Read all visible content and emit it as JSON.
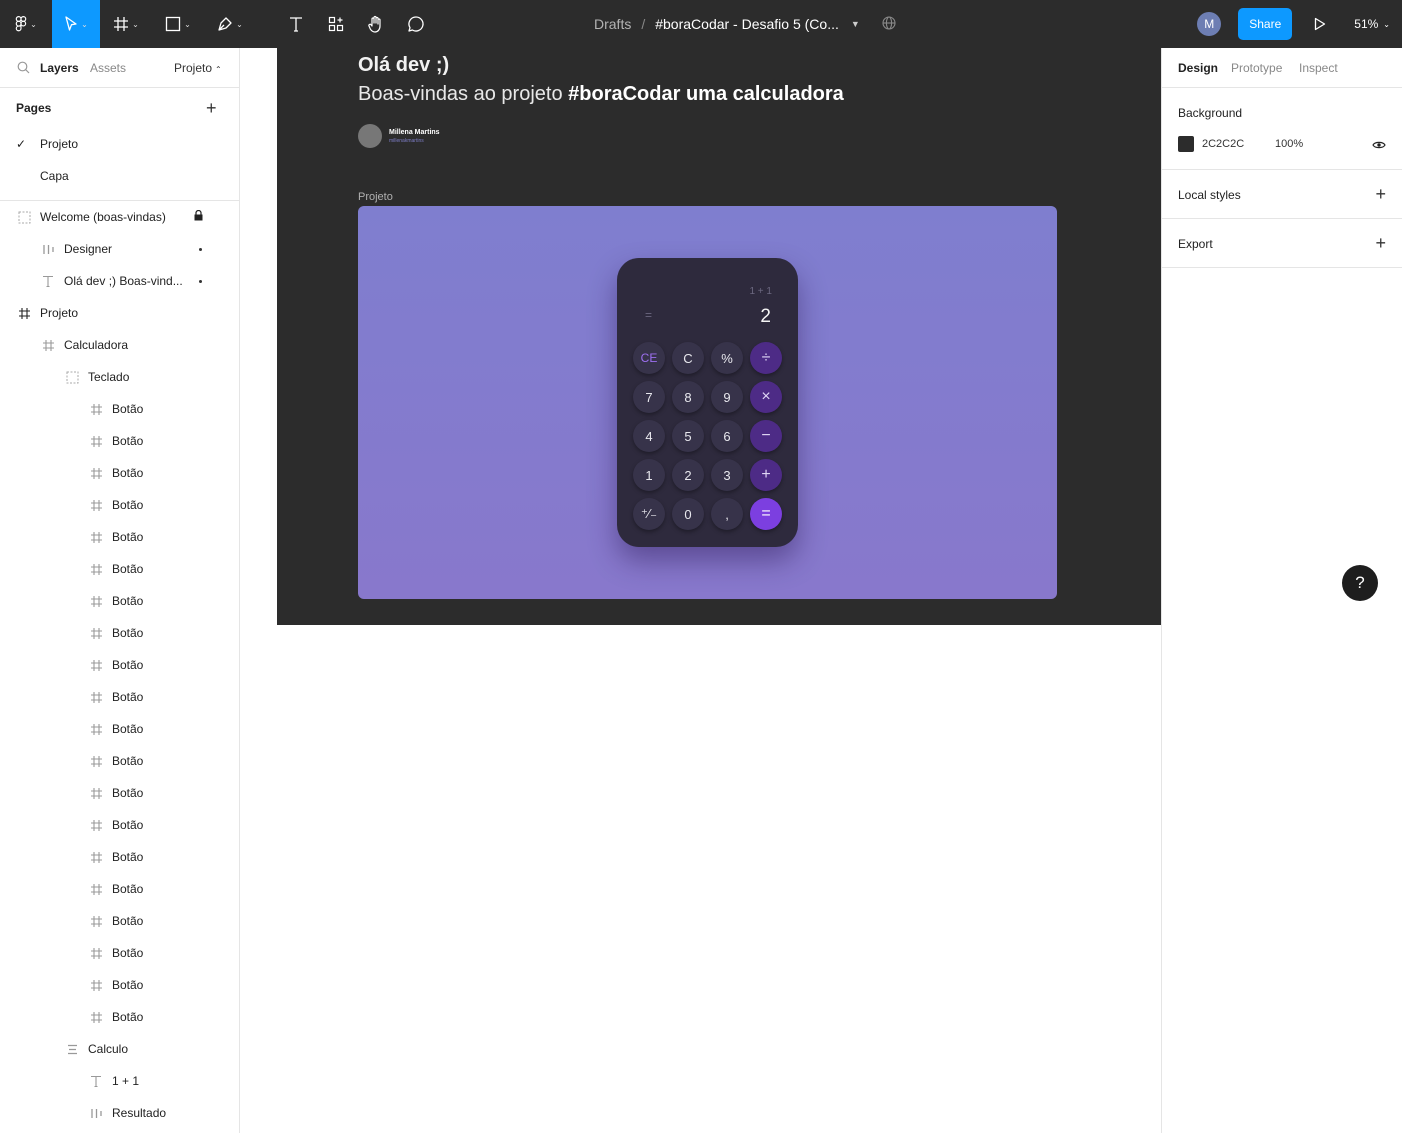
{
  "toolbar": {
    "breadcrumb_root": "Drafts",
    "separator": "/",
    "file_name": "#boraCodar - Desafio 5 (Co...",
    "avatar_initial": "M",
    "share_label": "Share",
    "zoom": "51%"
  },
  "left_panel": {
    "tabs": {
      "layers": "Layers",
      "assets": "Assets",
      "page_selector": "Projeto"
    },
    "pages_title": "Pages",
    "pages": [
      {
        "label": "Projeto",
        "current": true
      },
      {
        "label": "Capa",
        "current": false
      }
    ],
    "layers": [
      {
        "label": "Welcome (boas-vindas)",
        "icon": "section-icon",
        "locked": true
      },
      {
        "label": "Designer",
        "icon": "auto-layout-icon",
        "hidden_dot": true
      },
      {
        "label": "Olá dev ;) Boas-vind...",
        "icon": "text-icon",
        "hidden_dot": true
      },
      {
        "label": "Projeto",
        "icon": "frame-icon"
      },
      {
        "label": "Calculadora",
        "icon": "frame-icon"
      },
      {
        "label": "Teclado",
        "icon": "section-icon"
      },
      {
        "label": "Botão",
        "icon": "frame-icon"
      },
      {
        "label": "Botão",
        "icon": "frame-icon"
      },
      {
        "label": "Botão",
        "icon": "frame-icon"
      },
      {
        "label": "Botão",
        "icon": "frame-icon"
      },
      {
        "label": "Botão",
        "icon": "frame-icon"
      },
      {
        "label": "Botão",
        "icon": "frame-icon"
      },
      {
        "label": "Botão",
        "icon": "frame-icon"
      },
      {
        "label": "Botão",
        "icon": "frame-icon"
      },
      {
        "label": "Botão",
        "icon": "frame-icon"
      },
      {
        "label": "Botão",
        "icon": "frame-icon"
      },
      {
        "label": "Botão",
        "icon": "frame-icon"
      },
      {
        "label": "Botão",
        "icon": "frame-icon"
      },
      {
        "label": "Botão",
        "icon": "frame-icon"
      },
      {
        "label": "Botão",
        "icon": "frame-icon"
      },
      {
        "label": "Botão",
        "icon": "frame-icon"
      },
      {
        "label": "Botão",
        "icon": "frame-icon"
      },
      {
        "label": "Botão",
        "icon": "frame-icon"
      },
      {
        "label": "Botão",
        "icon": "frame-icon"
      },
      {
        "label": "Botão",
        "icon": "frame-icon"
      },
      {
        "label": "Botão",
        "icon": "frame-icon"
      },
      {
        "label": "Calculo",
        "icon": "auto-layout-vertical-icon"
      },
      {
        "label": "1 + 1",
        "icon": "text-icon"
      },
      {
        "label": "Resultado",
        "icon": "auto-layout-icon"
      }
    ]
  },
  "canvas": {
    "greeting": "Olá dev ;)",
    "welcome_prefix": "Boas-vindas ao projeto ",
    "welcome_bold": "#boraCodar uma calculadora",
    "designer_name": "Millena Martins",
    "designer_handle": "millenakmartins",
    "project_label": "Projeto",
    "calculator": {
      "expression": "1 + 1",
      "equals_sign": "=",
      "result": "2",
      "keys": [
        {
          "label": "CE",
          "kind": "ce"
        },
        {
          "label": "C",
          "kind": "num"
        },
        {
          "label": "%",
          "kind": "num"
        },
        {
          "label": "÷",
          "kind": "op"
        },
        {
          "label": "7",
          "kind": "num"
        },
        {
          "label": "8",
          "kind": "num"
        },
        {
          "label": "9",
          "kind": "num"
        },
        {
          "label": "×",
          "kind": "op"
        },
        {
          "label": "4",
          "kind": "num"
        },
        {
          "label": "5",
          "kind": "num"
        },
        {
          "label": "6",
          "kind": "num"
        },
        {
          "label": "−",
          "kind": "op"
        },
        {
          "label": "1",
          "kind": "num"
        },
        {
          "label": "2",
          "kind": "num"
        },
        {
          "label": "3",
          "kind": "num"
        },
        {
          "label": "+",
          "kind": "op"
        },
        {
          "label": "⁺∕₋",
          "kind": "num"
        },
        {
          "label": "0",
          "kind": "num"
        },
        {
          "label": ",",
          "kind": "num"
        },
        {
          "label": "=",
          "kind": "eq"
        }
      ]
    }
  },
  "right_panel": {
    "tabs": {
      "design": "Design",
      "prototype": "Prototype",
      "inspect": "Inspect"
    },
    "background_title": "Background",
    "background_hex": "2C2C2C",
    "background_opacity": "100%",
    "local_styles_title": "Local styles",
    "export_title": "Export"
  },
  "help_label": "?",
  "colors": {
    "toolbar": "#2c2c2c",
    "accent": "#0d99ff",
    "canvas_frame": "#2c2c2c",
    "project_bg": "#8079cd",
    "calc_body": "#2e2a3d",
    "op_key": "#4d2b86",
    "eq_key": "#7c3fe0"
  }
}
